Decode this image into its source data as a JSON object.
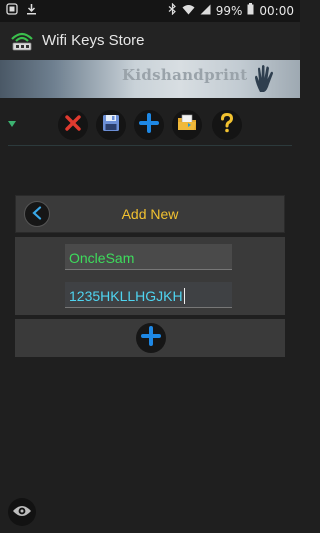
{
  "status_bar": {
    "battery": "99%",
    "time": "00:00"
  },
  "app_bar": {
    "title": "Wifi Keys Store"
  },
  "banner": {
    "brand": "Kidshandprint"
  },
  "panel": {
    "title": "Add New"
  },
  "form": {
    "ssid_value": "OncleSam",
    "key_value": "1235HKLLHGJKH"
  },
  "colors": {
    "accent_title": "#f2c230",
    "ssid_text": "#3ddc5c",
    "key_text": "#4fd4f0",
    "delete_red": "#e03a2f",
    "plus_blue": "#1e88e5"
  }
}
